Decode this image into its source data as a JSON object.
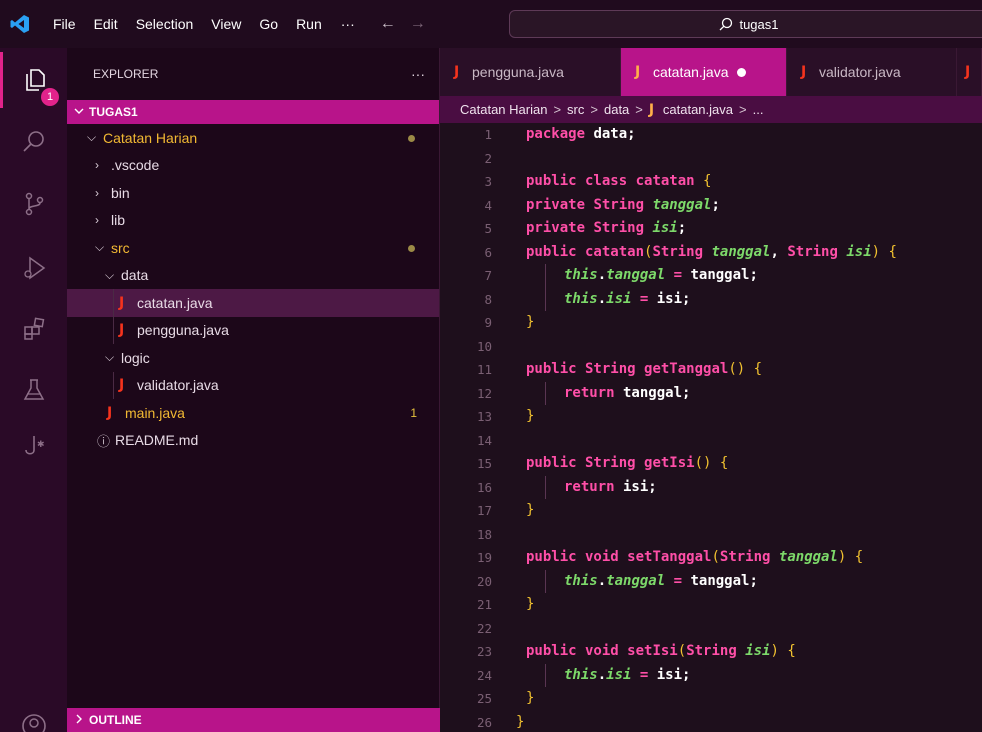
{
  "titlebar": {
    "menu": [
      "File",
      "Edit",
      "Selection",
      "View",
      "Go",
      "Run"
    ],
    "more": "···",
    "back": "←",
    "forward": "→",
    "search": "tugas1"
  },
  "activity": {
    "badge": "1",
    "icons": [
      "explorer-icon",
      "search-icon",
      "source-control-icon",
      "run-debug-icon",
      "extensions-icon",
      "testing-icon",
      "java-icon",
      "account-icon"
    ]
  },
  "sidebar": {
    "title": "EXPLORER",
    "more": "···",
    "section": "TUGAS1",
    "outline": "OUTLINE",
    "tree": {
      "catatan_harian": "Catatan Harian",
      "vscode": ".vscode",
      "bin": "bin",
      "lib": "lib",
      "src": "src",
      "data": "data",
      "catatan": "catatan.java",
      "pengguna": "pengguna.java",
      "logic": "logic",
      "validator": "validator.java",
      "main": "main.java",
      "main_count": "1",
      "readme": "README.md"
    }
  },
  "tabs": {
    "t1": "pengguna.java",
    "t2": "catatan.java",
    "t3": "validator.java"
  },
  "breadcrumb": {
    "p1": "Catatan Harian",
    "p2": "src",
    "p3": "data",
    "p4": "catatan.java",
    "p5": "..."
  },
  "code": {
    "l1a": "package",
    "l1b": " data;",
    "l3a": "public",
    "l3b": " class",
    "l3c": " catatan ",
    "l3d": "{",
    "l4a": "private",
    "l4b": " String ",
    "l4c": "tanggal",
    "l4d": ";",
    "l5a": "private",
    "l5b": " String ",
    "l5c": "isi",
    "l5d": ";",
    "l6a": "public",
    "l6b": " catatan",
    "l6c": "(",
    "l6d": "String ",
    "l6e": "tanggal",
    "l6f": ", ",
    "l6g": "String ",
    "l6h": "isi",
    "l6i": ") ",
    "l6j": "{",
    "l7a": "this",
    "l7b": ".",
    "l7c": "tanggal",
    "l7d": " = ",
    "l7e": "tanggal",
    "l7f": ";",
    "l8a": "this",
    "l8b": ".",
    "l8c": "isi",
    "l8d": " = ",
    "l8e": "isi",
    "l8f": ";",
    "close": "}",
    "l11a": "public",
    "l11b": " String",
    "l11c": " getTanggal",
    "l11d": "() ",
    "l11e": "{",
    "l12a": "return",
    "l12b": " tanggal",
    "l12c": ";",
    "l15a": "public",
    "l15b": " String",
    "l15c": " getIsi",
    "l15d": "() ",
    "l15e": "{",
    "l16a": "return",
    "l16b": " isi",
    "l16c": ";",
    "l19a": "public",
    "l19b": " void",
    "l19c": " setTanggal",
    "l19d": "(",
    "l19e": "String ",
    "l19f": "tanggal",
    "l19g": ") ",
    "l19h": "{",
    "l20a": "this",
    "l20b": ".",
    "l20c": "tanggal",
    "l20d": " = ",
    "l20e": "tanggal",
    "l20f": ";",
    "l23a": "public",
    "l23b": " void",
    "l23c": " setIsi",
    "l23d": "(",
    "l23e": "String ",
    "l23f": "isi",
    "l23g": ") ",
    "l23h": "{",
    "l24a": "this",
    "l24b": ".",
    "l24c": "isi",
    "l24d": " = ",
    "l24e": "isi",
    "l24f": ";",
    "numbers": [
      "1",
      "2",
      "3",
      "4",
      "5",
      "6",
      "7",
      "8",
      "9",
      "10",
      "11",
      "12",
      "13",
      "14",
      "15",
      "16",
      "17",
      "18",
      "19",
      "20",
      "21",
      "22",
      "23",
      "24",
      "25",
      "26"
    ]
  }
}
